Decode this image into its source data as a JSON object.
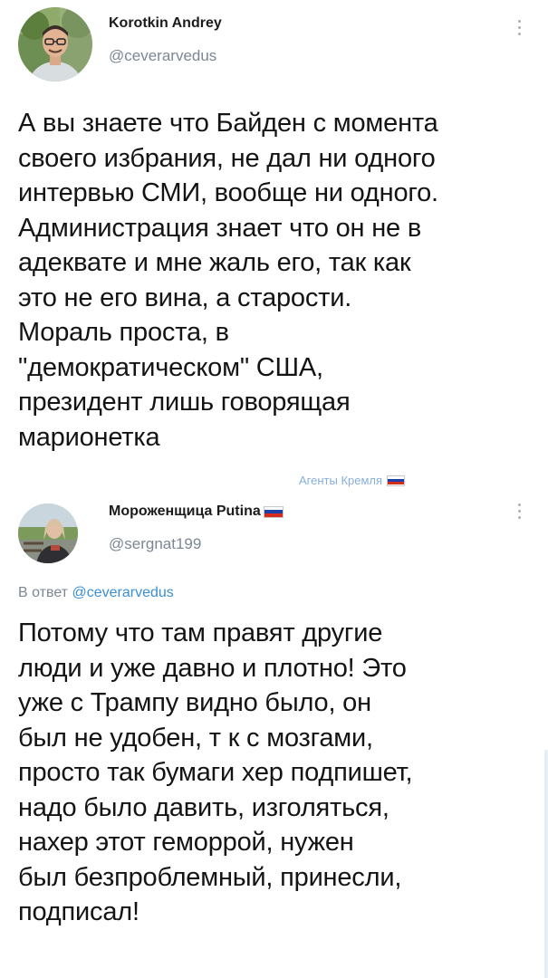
{
  "tweet1": {
    "author_name": "Korotkin Andrey",
    "author_handle": "@ceverarvedus",
    "avatar_icon": "person-photo-avatar",
    "menu_icon": "vertical-dots-icon",
    "text_lines": [
      "А вы знаете что Байден с момента",
      "своего избрания, не дал ни одного",
      "интервью СМИ, вообще ни одного.",
      "Администрация знает что он не в",
      "адеквате и мне жаль его, так как",
      "это не его вина, а старости.",
      "Мораль проста, в",
      "\"демократическом\" США,",
      "президент лишь говорящая",
      "марионетка"
    ]
  },
  "watermark": {
    "text": "Агенты Кремля",
    "flag_colors": [
      "#ffffff",
      "#1c3fa8",
      "#d52b1e"
    ]
  },
  "tweet2": {
    "author_name": "Мороженщица Putina",
    "author_handle": "@sergnat199",
    "avatar_icon": "person-photo-avatar",
    "menu_icon": "vertical-dots-icon",
    "reply_prefix": "В ответ",
    "reply_to": "@ceverarvedus",
    "text_lines": [
      "Потому что там правят другие",
      "люди и уже давно и плотно! Это",
      "уже с Трампу видно было, он",
      "был не удобен, т к с мозгами,",
      "просто так бумаги хер подпишет,",
      "надо было давить, изголяться,",
      "нахер этот геморрой, нужен",
      "был безпроблемный, принесли,",
      "подписал!"
    ]
  },
  "colors": {
    "handle": "#7b8794",
    "link": "#3a8fd6",
    "watermark": "#88aede",
    "text": "#141414"
  }
}
